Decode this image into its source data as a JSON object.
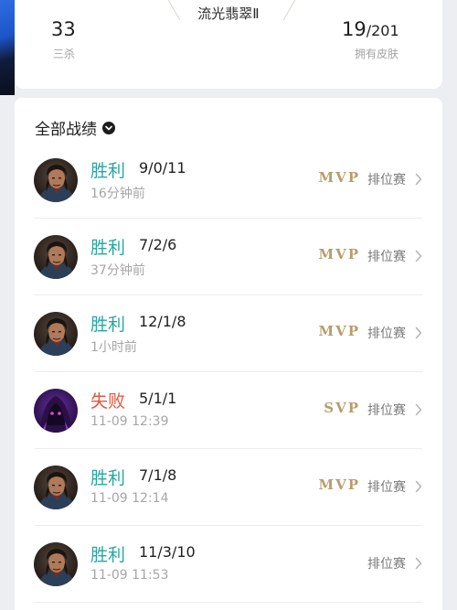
{
  "profile": {
    "rank_name": "流光翡翠Ⅱ",
    "kills": {
      "value": "33",
      "label": "三杀"
    },
    "skins": {
      "owned": "19",
      "total": "/201",
      "label": "拥有皮肤"
    }
  },
  "history": {
    "title": "全部战绩",
    "matches": [
      {
        "result": "胜利",
        "outcome": "win",
        "kda": "9/0/11",
        "time": "16分钟前",
        "badge": "MVP",
        "mode": "排位赛",
        "hero": "dark-haired-hero"
      },
      {
        "result": "胜利",
        "outcome": "win",
        "kda": "7/2/6",
        "time": "37分钟前",
        "badge": "MVP",
        "mode": "排位赛",
        "hero": "dark-haired-hero"
      },
      {
        "result": "胜利",
        "outcome": "win",
        "kda": "12/1/8",
        "time": "1小时前",
        "badge": "MVP",
        "mode": "排位赛",
        "hero": "dark-haired-hero"
      },
      {
        "result": "失败",
        "outcome": "loss",
        "kda": "5/1/1",
        "time": "11-09 12:39",
        "badge": "SVP",
        "mode": "排位赛",
        "hero": "purple-hooded-hero"
      },
      {
        "result": "胜利",
        "outcome": "win",
        "kda": "7/1/8",
        "time": "11-09 12:14",
        "badge": "MVP",
        "mode": "排位赛",
        "hero": "dark-haired-hero"
      },
      {
        "result": "胜利",
        "outcome": "win",
        "kda": "11/3/10",
        "time": "11-09 11:53",
        "badge": "",
        "mode": "排位赛",
        "hero": "dark-haired-hero"
      }
    ]
  },
  "colors": {
    "win": "#2aa5a0",
    "loss": "#e2553b",
    "badge_gold": "#b79d6b"
  },
  "icons": {
    "dropdown": "chevron-down-circle-icon",
    "row_arrow": "chevron-right-icon"
  }
}
